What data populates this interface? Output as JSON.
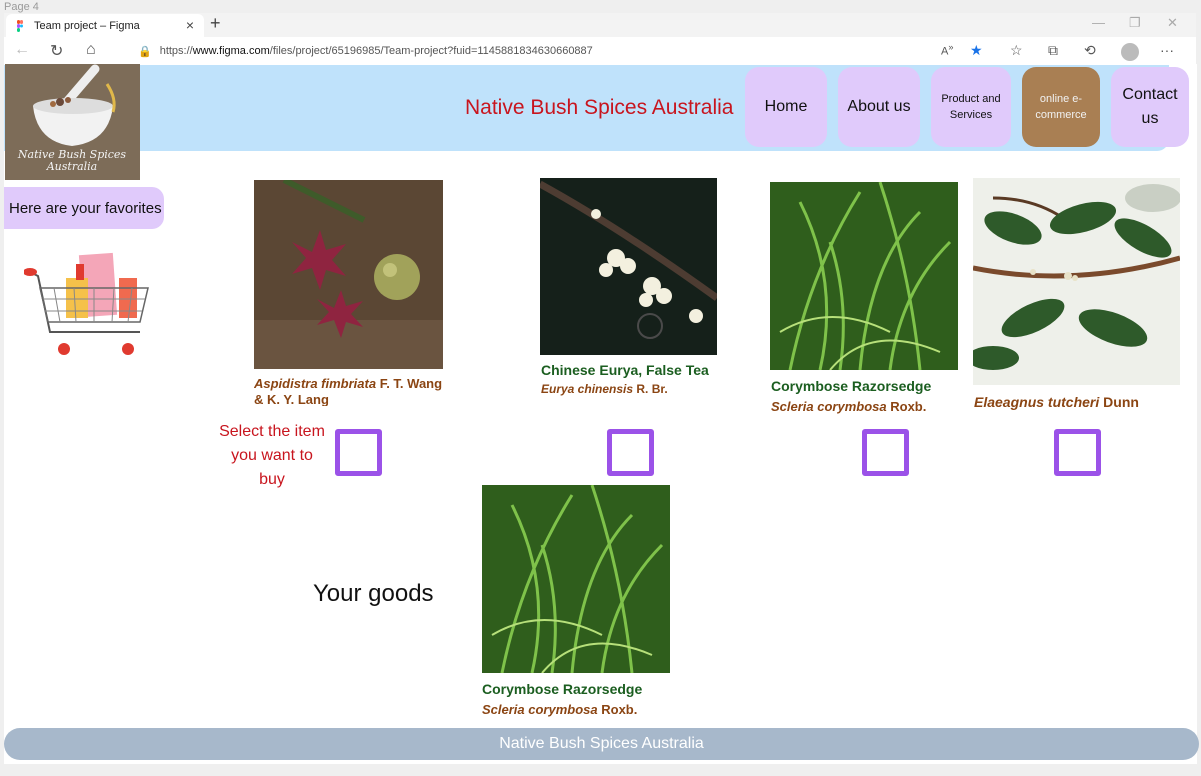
{
  "page_label": "Page 4",
  "browser": {
    "tab_title": "Team project – Figma",
    "url_prefix": "https://",
    "url_domain": "www.figma.com",
    "url_path": "/files/project/65196985/Team-project?fuid=1145881834630660887"
  },
  "header": {
    "logo_text": "Native Bush Spices Australia",
    "site_title": "Native Bush Spices Australia",
    "nav": {
      "home": "Home",
      "about": "About us",
      "products": "Product and Services",
      "ecommerce": "online e-commerce",
      "contact": "Contact us"
    }
  },
  "sidebar": {
    "favorites_label": "Here are your favorites"
  },
  "products": [
    {
      "common": "",
      "scientific": "Aspidistra fimbriata",
      "author": " F. T. Wang & K. Y. Lang"
    },
    {
      "common": "Chinese Eurya, False Tea",
      "scientific": "Eurya chinensis",
      "author": " R. Br."
    },
    {
      "common": "Corymbose Razorsedge",
      "scientific": "Scleria corymbosa",
      "author": " Roxb."
    },
    {
      "common": "",
      "scientific": "Elaeagnus tutcheri",
      "author": " Dunn"
    }
  ],
  "select_note": "Select the item you want to buy",
  "your_goods": {
    "label": "Your goods",
    "item": {
      "common": "Corymbose Razorsedge",
      "scientific": "Scleria corymbosa",
      "author": " Roxb."
    }
  },
  "footer": {
    "text": "Native Bush Spices Australia"
  },
  "colors": {
    "header_bg": "#bfe2fb",
    "nav_button": "#e0cafb",
    "ecommerce_button": "#a97f53",
    "title_red": "#c8151e",
    "checkbox_purple": "#9b52e8",
    "footer_bg": "#a7b8cb"
  }
}
